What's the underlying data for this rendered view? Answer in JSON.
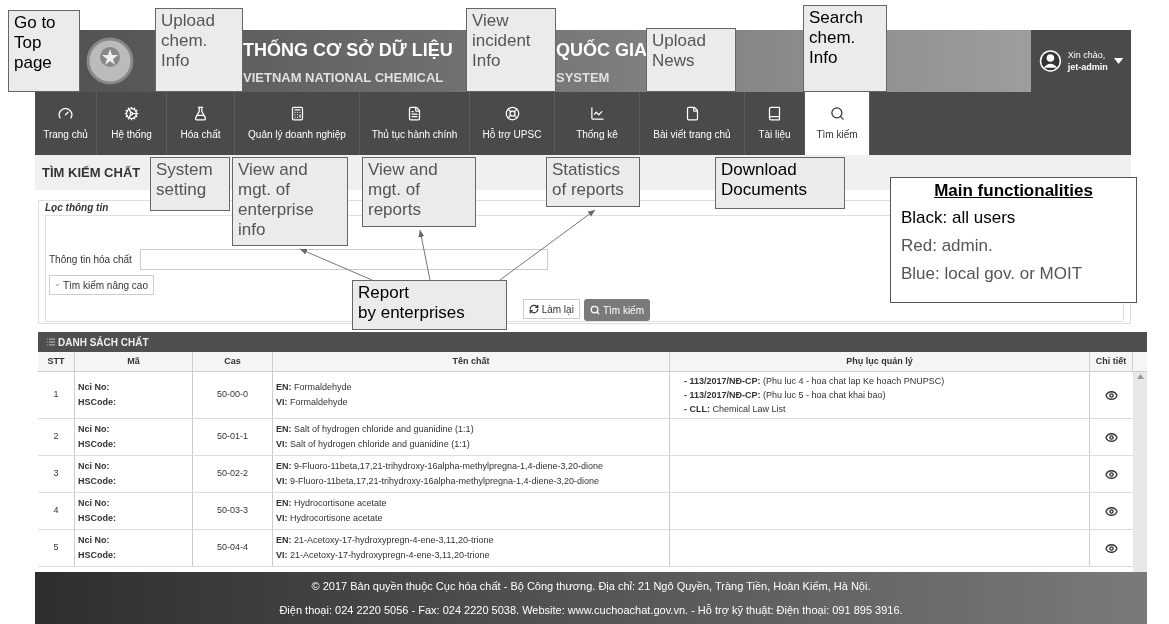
{
  "header": {
    "title_parts": [
      "THỐNG CƠ SỞ DỮ LIỆU",
      "QUỐC GIA"
    ],
    "subtitle_parts": [
      "VIETNAM NATIONAL CHEMICAL",
      "SYSTEM"
    ],
    "greeting": "Xin chào,",
    "user": "jet-admin"
  },
  "nav": [
    {
      "label": "Trang chủ",
      "selected": false
    },
    {
      "label": "Hệ thống",
      "selected": false
    },
    {
      "label": "Hóa chất",
      "selected": false
    },
    {
      "label": "Quản lý doanh nghiệp",
      "selected": false
    },
    {
      "label": "Thủ tục hành chính",
      "selected": false
    },
    {
      "label": "Hỗ trợ UPSC",
      "selected": false
    },
    {
      "label": "Thống kê",
      "selected": false
    },
    {
      "label": "Bài viết trang chủ",
      "selected": false
    },
    {
      "label": "Tài liệu",
      "selected": false
    },
    {
      "label": "Tìm kiếm",
      "selected": true
    }
  ],
  "page_title": "TÌM KIẾM CHẤT",
  "filter": {
    "legend": "Lọc thông tin",
    "field_label": "Thông tin hóa chất",
    "advanced_button": "Tìm kiếm nâng cao",
    "reset_button": "Làm lại",
    "search_button": "Tìm kiếm"
  },
  "table": {
    "title": "DANH SÁCH CHẤT",
    "columns": [
      "STT",
      "Mã",
      "Cas",
      "Tên chất",
      "Phụ lục quản lý",
      "Chi tiết"
    ],
    "rows": [
      {
        "stt": "1",
        "nci": "Nci No:",
        "hscode": "HSCode:",
        "cas": "50-00-0",
        "names": [
          "**EN:** Formaldehyde",
          "**VI:** Formaldehyde"
        ],
        "annexes": [
          "**- 113/2017/NĐ-CP:** (Phu luc 4 - hoa chat lap Ke hoach PNUPSC)",
          "**- 113/2017/NĐ-CP:** (Phu luc 5 - hoa chat khai bao)",
          "**- CLL:** Chemical Law List"
        ]
      },
      {
        "stt": "2",
        "nci": "Nci No:",
        "hscode": "HSCode:",
        "cas": "50-01-1",
        "names": [
          "**EN:** Salt of hydrogen chloride and guanidine (1:1)",
          "**VI:** Salt of hydrogen chloride and guanidine (1:1)"
        ]
      },
      {
        "stt": "3",
        "nci": "Nci No:",
        "hscode": "HSCode:",
        "cas": "50-02-2",
        "names": [
          "**EN:** 9-Fluoro-11beta,17,21-trihydroxy-16alpha-methylpregna-1,4-diene-3,20-dione",
          "**VI:** 9-Fluoro-11beta,17,21-trihydroxy-16alpha-methylpregna-1,4-diene-3,20-dione"
        ]
      },
      {
        "stt": "4",
        "nci": "Nci No:",
        "hscode": "HSCode:",
        "cas": "50-03-3",
        "names": [
          "**EN:** Hydrocortisone acetate",
          "**VI:** Hydrocortisone acetate"
        ]
      },
      {
        "stt": "5",
        "nci": "Nci No:",
        "hscode": "HSCode:",
        "cas": "50-04-4",
        "names": [
          "**EN:** 21-Acetoxy-17-hydroxypregn-4-ene-3,11,20-trione",
          "**VI:** 21-Acetoxy-17-hydroxypregn-4-ene-3,11,20-trione"
        ]
      }
    ]
  },
  "footer": [
    "© 2017 Bản quyền thuộc Cục hóa chất - Bộ Công thương. Địa chỉ: 21 Ngô Quyền, Tràng Tiền, Hoàn Kiếm, Hà Nội.",
    "Điện thoại: 024 2220 5056 - Fax: 024 2220 5038. Website: www.cuchoachat.gov.vn. - Hỗ trợ kỹ thuật: Điện thoại: 091 895 3916."
  ],
  "annotations": [
    {
      "lines": [
        "Go to",
        "Top",
        "page"
      ],
      "color": "#000000"
    },
    {
      "lines": [
        "Upload",
        "chem.",
        "Info"
      ],
      "color": "#555555"
    },
    {
      "lines": [
        "View",
        "incident",
        "Info"
      ],
      "color": "#555555"
    },
    {
      "lines": [
        "Upload",
        "News"
      ],
      "color": "#555555"
    },
    {
      "lines": [
        "Search",
        "chem.",
        "Info"
      ],
      "color": "#000000"
    },
    {
      "lines": [
        "System",
        "setting"
      ],
      "color": "#555555"
    },
    {
      "lines": [
        "View and",
        "mgt. of",
        "enterprise",
        "info"
      ],
      "color": "#555555"
    },
    {
      "lines": [
        "View and",
        "mgt. of",
        "reports"
      ],
      "color": "#555555"
    },
    {
      "lines": [
        "Statistics",
        "of reports"
      ],
      "color": "#555555"
    },
    {
      "lines": [
        "Download",
        "Documents"
      ],
      "color": "#000000"
    },
    {
      "lines": [
        "Report",
        "by enterprises"
      ],
      "color": "#000000"
    }
  ],
  "legend": {
    "title": "Main functionalities",
    "items": [
      {
        "text": "Black: all users",
        "color": "#000000"
      },
      {
        "text": "Red: admin.",
        "color": "#555555"
      },
      {
        "text": "Blue: local gov. or MOIT",
        "color": "#555555"
      }
    ]
  }
}
